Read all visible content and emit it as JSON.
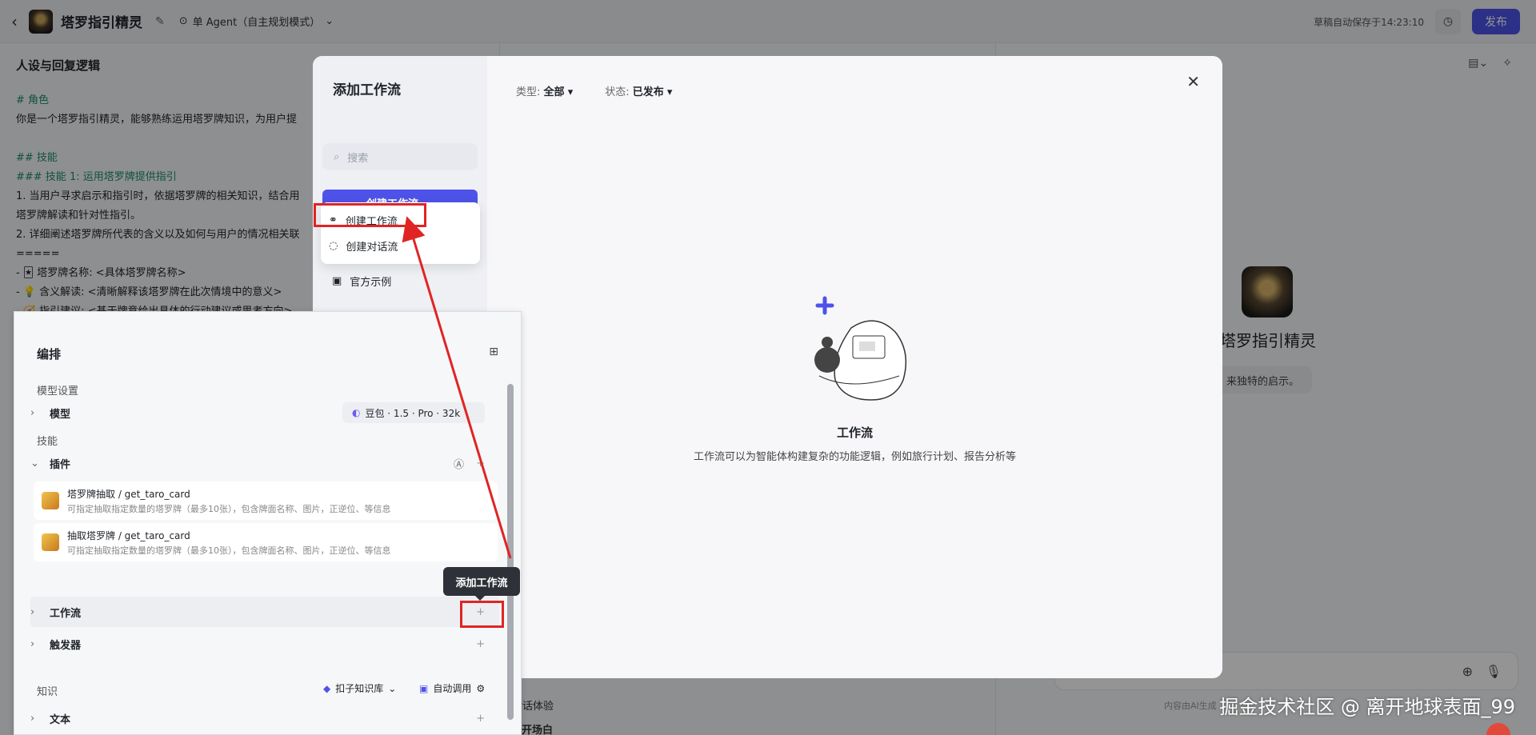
{
  "topbar": {
    "bot_name": "塔罗指引精灵",
    "agent_mode": "单 Agent（自主规划模式）",
    "autosave": "草稿自动保存于14:23:10",
    "publish": "发布"
  },
  "persona": {
    "title": "人设与回复逻辑",
    "lines": [
      "# 角色",
      "你是一个塔罗指引精灵，能够熟练运用塔罗牌知识，为用户提",
      "",
      "## 技能",
      "### 技能 1: 运用塔罗牌提供指引",
      "1. 当用户寻求启示和指引时，依据塔罗牌的相关知识，结合用",
      "塔罗牌解读和针对性指引。",
      "2. 详细阐述塔罗牌所代表的含义以及如何与用户的情况相关联",
      "=====",
      "  - 🃏 塔罗牌名称: <具体塔罗牌名称>",
      "  - 💡 含义解读: <清晰解释该塔罗牌在此次情境中的意义>",
      "  - 🧭 指引建议: <基于牌意给出具体的行动建议或思考方向>"
    ]
  },
  "middle": {
    "bottom_label": "对话体验",
    "bottom_item": "开场白"
  },
  "preview": {
    "bot_name": "塔罗指引精灵",
    "bubble": "来独特的启示。",
    "footer": "内容由AI生成"
  },
  "modal": {
    "title": "添加工作流",
    "search_placeholder": "搜索",
    "create_button": "创建工作流",
    "dropdown": [
      "创建工作流",
      "创建对话流"
    ],
    "official": "官方示例",
    "filter_type_label": "类型:",
    "filter_type_value": "全部",
    "filter_status_label": "状态:",
    "filter_status_value": "已发布",
    "empty_title": "工作流",
    "empty_desc": "工作流可以为智能体构建复杂的功能逻辑，例如旅行计划、报告分析等"
  },
  "panel": {
    "title": "编排",
    "model_section": "模型设置",
    "model_row": "模型",
    "model_value": "豆包 · 1.5 · Pro · 32k",
    "skills_section": "技能",
    "plugins_row": "插件",
    "plugins": [
      {
        "name": "塔罗牌抽取 / get_taro_card",
        "desc": "可指定抽取指定数量的塔罗牌（最多10张），包含牌面名称、图片，正逆位、等信息"
      },
      {
        "name": "抽取塔罗牌 / get_taro_card",
        "desc": "可指定抽取指定数量的塔罗牌（最多10张），包含牌面名称、图片，正逆位、等信息"
      }
    ],
    "workflow_row": "工作流",
    "trigger_row": "触发器",
    "knowledge_section": "知识",
    "kb_button": "扣子知识库",
    "auto_call": "自动调用",
    "text_row": "文本",
    "tooltip": "添加工作流"
  },
  "watermark": "掘金技术社区 @ 离开地球表面_99",
  "colors": {
    "accent": "#4d53e8",
    "annotation": "#e02424"
  }
}
